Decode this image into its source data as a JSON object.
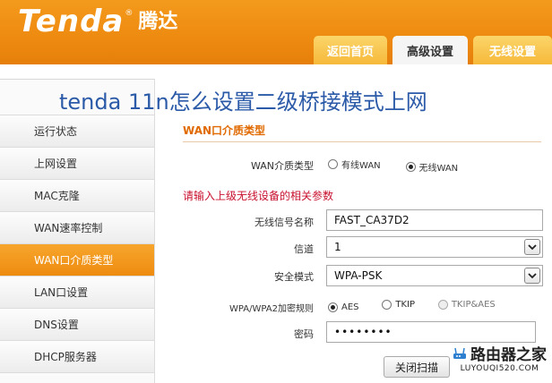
{
  "header": {
    "logo_en": "Tenda",
    "logo_reg": "®",
    "logo_cn": "腾达",
    "tabs": [
      {
        "label": "返回首页"
      },
      {
        "label": "高级设置"
      },
      {
        "label": "无线设置"
      }
    ]
  },
  "overlay_title": "tenda 11n怎么设置二级桥接模式上网",
  "sidebar": {
    "items": [
      {
        "label": "运行状态"
      },
      {
        "label": "上网设置"
      },
      {
        "label": "MAC克隆"
      },
      {
        "label": "WAN速率控制"
      },
      {
        "label": "WAN口介质类型",
        "active": true
      },
      {
        "label": "LAN口设置"
      },
      {
        "label": "DNS设置"
      },
      {
        "label": "DHCP服务器"
      }
    ]
  },
  "main": {
    "section_title": "WAN口介质类型",
    "wan_type": {
      "label": "WAN介质类型",
      "options": [
        "有线WAN",
        "无线WAN"
      ],
      "selected": "无线WAN"
    },
    "notice": "请输入上级无线设备的相关参数",
    "ssid": {
      "label": "无线信号名称",
      "value": "FAST_CA37D2"
    },
    "channel": {
      "label": "信道",
      "value": "1"
    },
    "security": {
      "label": "安全模式",
      "value": "WPA-PSK"
    },
    "encryption": {
      "label": "WPA/WPA2加密规则",
      "options": [
        "AES",
        "TKIP",
        "TKIP&AES"
      ],
      "selected": "AES"
    },
    "password": {
      "label": "密码",
      "value": "••••••••"
    },
    "close_scan_button": "关闭扫描"
  },
  "watermark": {
    "cn": "路由器之家",
    "url": "LUYOUQI520.COM"
  }
}
